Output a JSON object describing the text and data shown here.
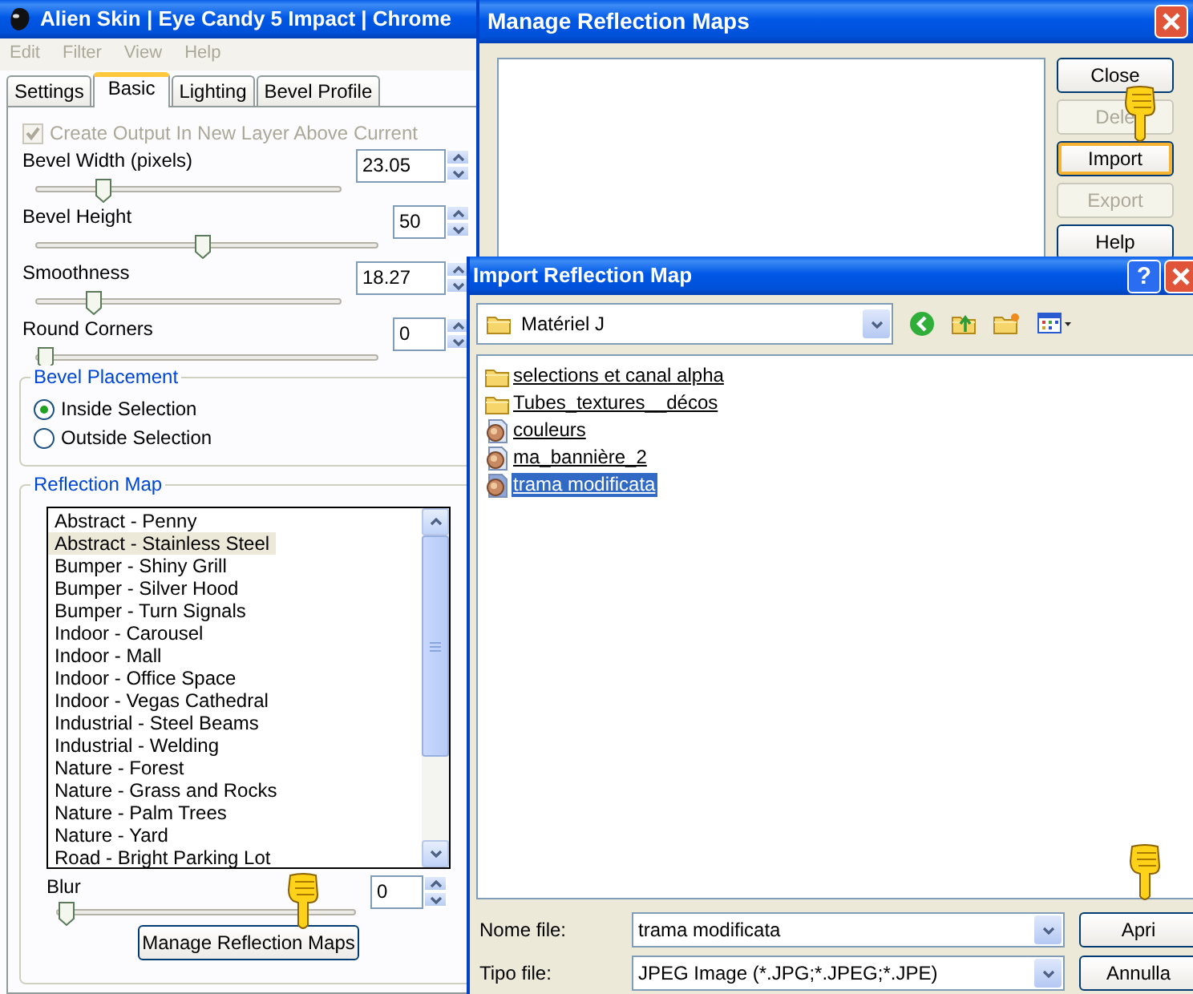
{
  "main_window": {
    "title": "Alien Skin | Eye Candy 5 Impact | Chrome",
    "menu": [
      {
        "label": "Edit",
        "disabled": true
      },
      {
        "label": "Filter",
        "disabled": true
      },
      {
        "label": "View",
        "disabled": true
      },
      {
        "label": "Help",
        "disabled": true
      }
    ],
    "tabs": [
      {
        "label": "Settings",
        "selected": false
      },
      {
        "label": "Basic",
        "selected": true
      },
      {
        "label": "Lighting",
        "selected": false
      },
      {
        "label": "Bevel Profile",
        "selected": false
      }
    ],
    "create_output": {
      "label": "Create Output In New Layer Above Current",
      "checked": true,
      "disabled": true
    },
    "sliders": [
      {
        "label": "Bevel Width (pixels)",
        "value": "23.05",
        "level": 0.2
      },
      {
        "label": "Bevel Height",
        "value": "50",
        "level": 0.49
      },
      {
        "label": "Smoothness",
        "value": "18.27",
        "level": 0.17
      },
      {
        "label": "Round Corners",
        "value": "0",
        "level": 0
      }
    ],
    "bevel_placement": {
      "title": "Bevel Placement",
      "options": [
        {
          "label": "Inside Selection",
          "selected": true
        },
        {
          "label": "Outside Selection",
          "selected": false
        }
      ]
    },
    "reflection_map": {
      "title": "Reflection Map",
      "items": [
        {
          "label": "Abstract - Penny",
          "selected": false
        },
        {
          "label": "Abstract - Stainless Steel",
          "selected": true
        },
        {
          "label": "Bumper - Shiny Grill",
          "selected": false
        },
        {
          "label": "Bumper - Silver Hood",
          "selected": false
        },
        {
          "label": "Bumper - Turn Signals",
          "selected": false
        },
        {
          "label": "Indoor - Carousel",
          "selected": false
        },
        {
          "label": "Indoor - Mall",
          "selected": false
        },
        {
          "label": "Indoor - Office Space",
          "selected": false
        },
        {
          "label": "Indoor - Vegas Cathedral",
          "selected": false
        },
        {
          "label": "Industrial - Steel Beams",
          "selected": false
        },
        {
          "label": "Industrial - Welding",
          "selected": false
        },
        {
          "label": "Nature - Forest",
          "selected": false
        },
        {
          "label": "Nature - Grass and Rocks",
          "selected": false
        },
        {
          "label": "Nature - Palm Trees",
          "selected": false
        },
        {
          "label": "Nature - Yard",
          "selected": false
        },
        {
          "label": "Road - Bright Parking Lot",
          "selected": false
        }
      ],
      "blur": {
        "label": "Blur",
        "value": "0",
        "level": 0
      },
      "button": "Manage Reflection Maps"
    }
  },
  "manage_dialog": {
    "title": "Manage Reflection Maps",
    "buttons": [
      {
        "label": "Close",
        "disabled": false,
        "hover": false
      },
      {
        "label": "Dele",
        "disabled": true,
        "hover": false
      },
      {
        "label": "Import",
        "disabled": false,
        "hover": true
      },
      {
        "label": "Export",
        "disabled": true,
        "hover": false
      },
      {
        "label": "Help",
        "disabled": false,
        "hover": false
      }
    ]
  },
  "import_dialog": {
    "title": "Import Reflection Map",
    "help_glyph": "?",
    "location": "Matériel J",
    "files": [
      {
        "name": "selections et canal alpha",
        "kind": "folder",
        "selected": false
      },
      {
        "name": "Tubes_textures__décos",
        "kind": "folder",
        "selected": false
      },
      {
        "name": "couleurs",
        "kind": "image",
        "selected": false
      },
      {
        "name": "ma_bannière_2",
        "kind": "image",
        "selected": false
      },
      {
        "name": "trama modificata",
        "kind": "image",
        "selected": true
      }
    ],
    "file_name": {
      "label": "Nome file:",
      "value": "trama modificata"
    },
    "file_type": {
      "label": "Tipo file:",
      "value": "JPEG Image (*.JPG;*.JPEG;*.JPE)"
    },
    "buttons": [
      "Apri",
      "Annulla"
    ]
  }
}
